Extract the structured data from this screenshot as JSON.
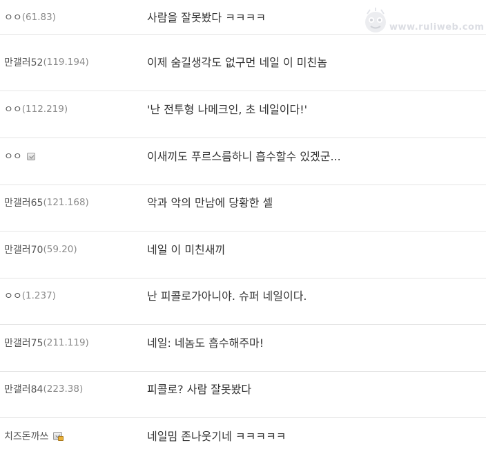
{
  "watermark": {
    "text": "www.ruliweb.com",
    "icon": "mascot-logo-icon"
  },
  "comments": [
    {
      "name": "ㅇㅇ",
      "ip": "(61.83)",
      "badge": "",
      "text": "사람을 잘못봤다 ㅋㅋㅋㅋ"
    },
    {
      "name": "만갤러52",
      "ip": "(119.194)",
      "badge": "",
      "text": "이제 숨길생각도 없구먼 네일 이 미친놈"
    },
    {
      "name": "ㅇㅇ",
      "ip": "(112.219)",
      "badge": "",
      "text": "'난 전투형 나메크인, 초 네일이다!'"
    },
    {
      "name": "ㅇㅇ",
      "ip": "",
      "badge": "member-icon",
      "text": "이새끼도 푸르스름하니 흡수할수 있겠군..."
    },
    {
      "name": "만갤러65",
      "ip": "(121.168)",
      "badge": "",
      "text": "악과 악의 만남에 당황한 셀"
    },
    {
      "name": "만갤러70",
      "ip": "(59.20)",
      "badge": "",
      "text": "네일 이 미친새끼"
    },
    {
      "name": "ㅇㅇ",
      "ip": "(1.237)",
      "badge": "",
      "text": "난 피콜로가아니야. 슈퍼 네일이다."
    },
    {
      "name": "만갤러75",
      "ip": "(211.119)",
      "badge": "",
      "text": "네일: 네놈도 흡수해주마!"
    },
    {
      "name": "만갤러84",
      "ip": "(223.38)",
      "badge": "",
      "text": "피콜로? 사람 잘못봤다"
    },
    {
      "name": "치즈돈까쓰",
      "ip": "",
      "badge": "member-lock-icon",
      "text": "네일밈 존나웃기네 ㅋㅋㅋㅋㅋ"
    }
  ]
}
